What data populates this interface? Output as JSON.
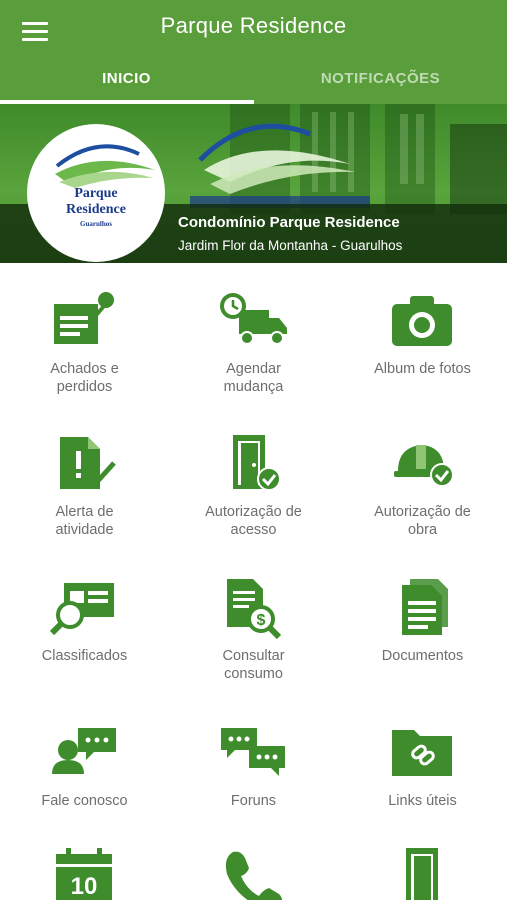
{
  "header": {
    "title": "Parque Residence",
    "menu_icon": "hamburger-menu-icon"
  },
  "tabs": [
    {
      "label": "INICIO",
      "active": true
    },
    {
      "label": "NOTIFICAÇÕES",
      "active": false
    }
  ],
  "banner": {
    "logo": {
      "name_line1": "Parque",
      "name_line2": "Residence",
      "city": "Guarulhos"
    },
    "condo_name": "Condomínio Parque Residence",
    "address": "Jardim Flor da Montanha - Guarulhos"
  },
  "colors": {
    "primary": "#5a9e3c",
    "icon": "#3e8c2c",
    "label": "#6e6e6e"
  },
  "menu": [
    {
      "label": "Achados e\nperdidos",
      "icon": "lost-and-found-icon"
    },
    {
      "label": "Agendar\nmudança",
      "icon": "moving-truck-icon"
    },
    {
      "label": "Album de fotos",
      "icon": "camera-icon"
    },
    {
      "label": "Alerta de\natividade",
      "icon": "activity-alert-icon"
    },
    {
      "label": "Autorização de\nacesso",
      "icon": "access-door-icon"
    },
    {
      "label": "Autorização de\nobra",
      "icon": "hard-hat-icon"
    },
    {
      "label": "Classificados",
      "icon": "classifieds-icon"
    },
    {
      "label": "Consultar\nconsumo",
      "icon": "consumption-icon"
    },
    {
      "label": "Documentos",
      "icon": "documents-icon"
    },
    {
      "label": "Fale conosco",
      "icon": "contact-icon"
    },
    {
      "label": "Foruns",
      "icon": "forums-icon"
    },
    {
      "label": "Links úteis",
      "icon": "links-folder-icon"
    },
    {
      "label": "",
      "icon": "calendar-icon",
      "calendar_day": "10"
    },
    {
      "label": "",
      "icon": "phone-icon"
    },
    {
      "label": "",
      "icon": "door-icon"
    }
  ]
}
